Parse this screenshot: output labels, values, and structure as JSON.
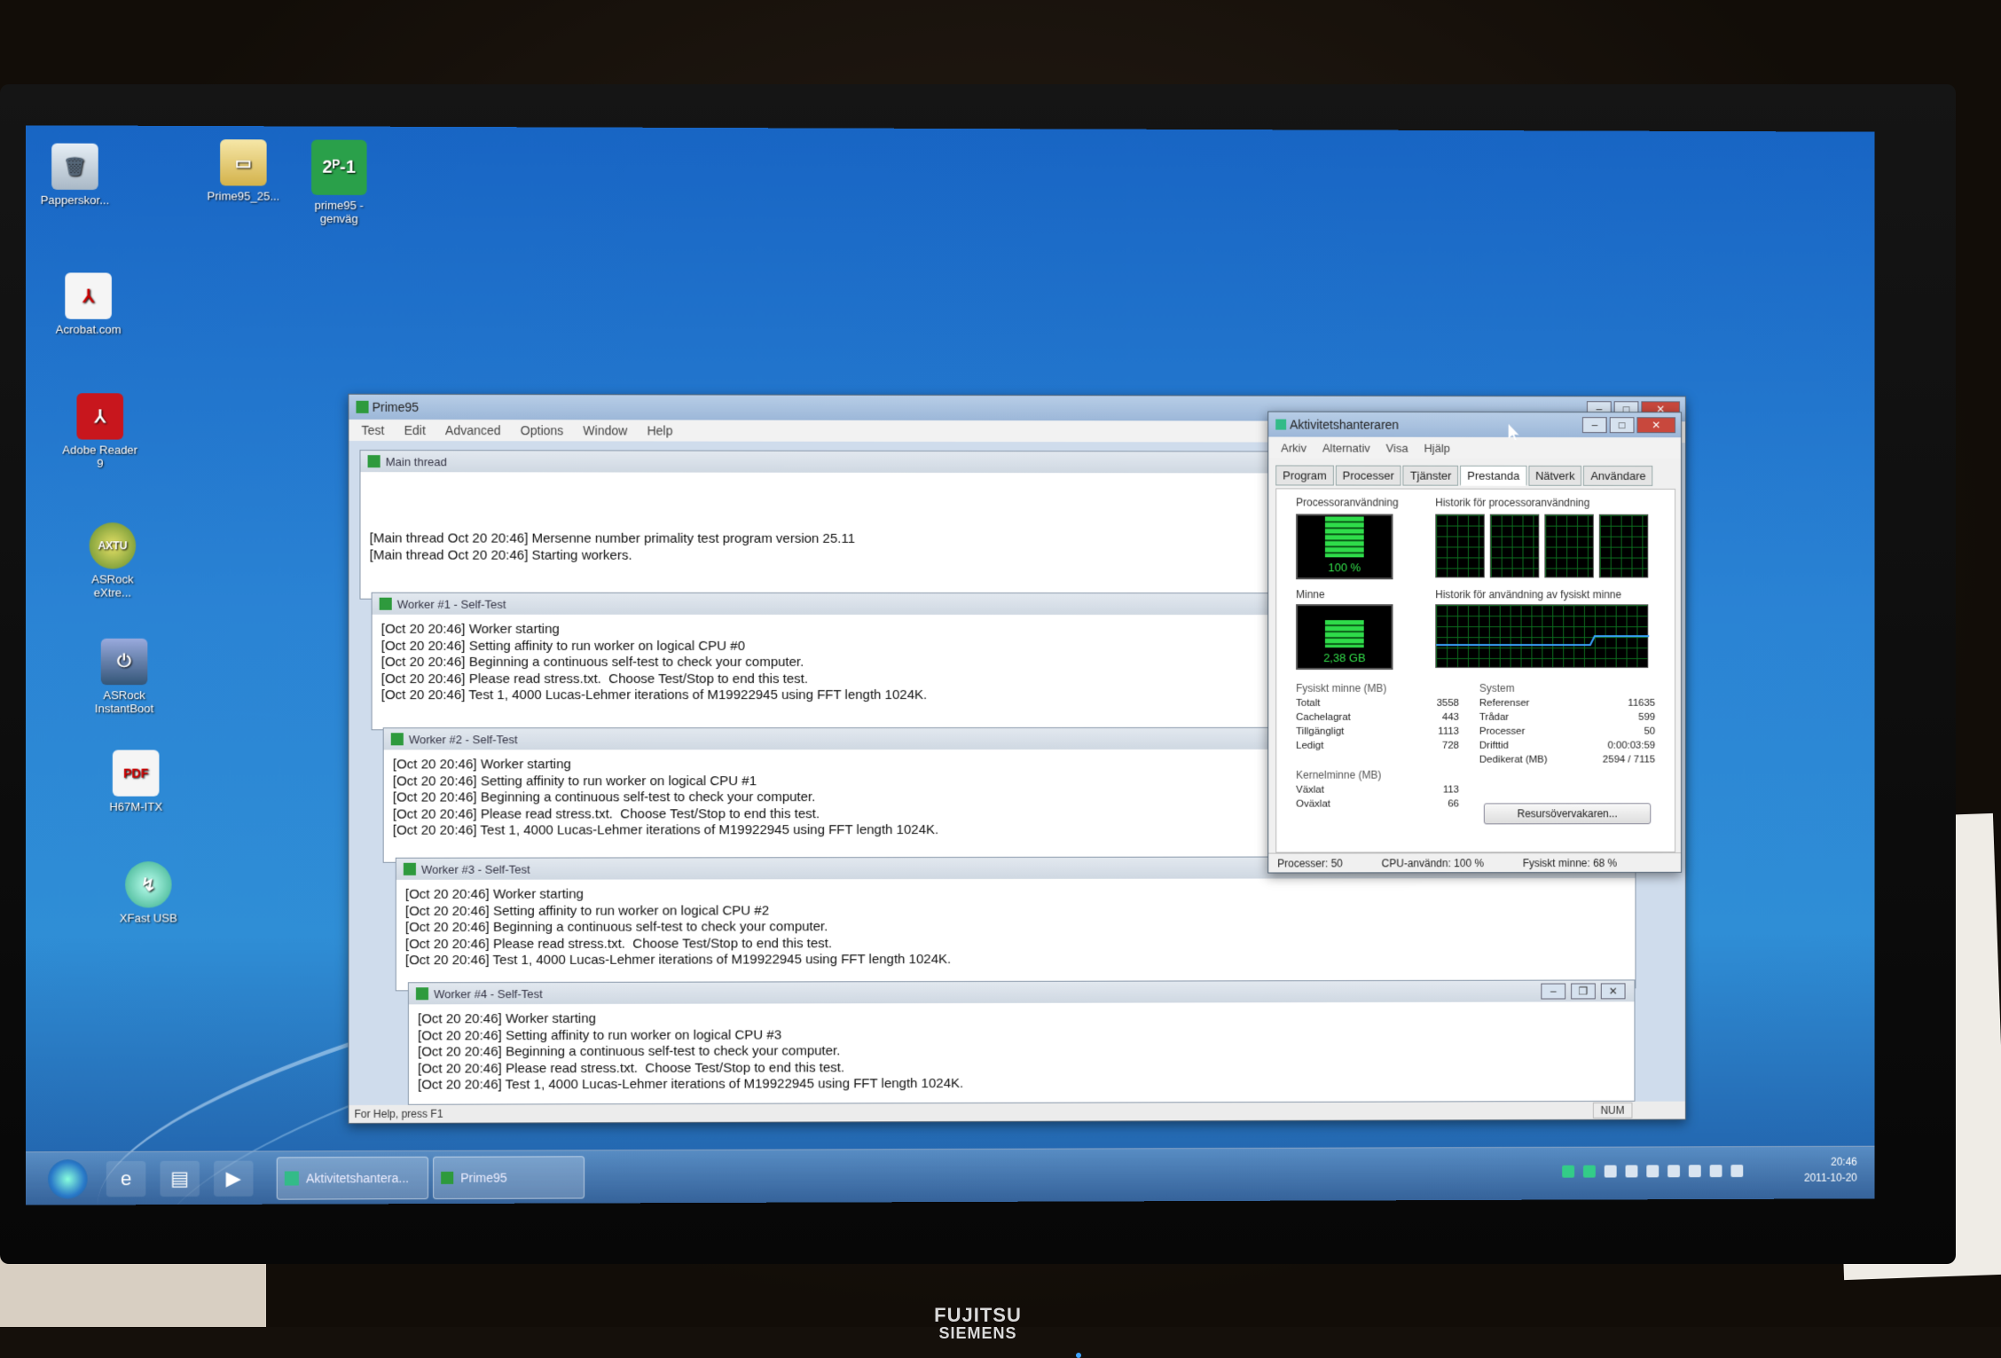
{
  "desktop": {
    "icons": [
      {
        "label": "Papperskor..."
      },
      {
        "label": "Prime95_25..."
      },
      {
        "label": "prime95 -"
      },
      {
        "label": "genväg"
      },
      {
        "label": "Acrobat.com"
      },
      {
        "label": "Adobe Reader"
      },
      {
        "label": "9"
      },
      {
        "label": "ASRock"
      },
      {
        "label": "eXtre..."
      },
      {
        "label": "ASRock"
      },
      {
        "label": "InstantBoot"
      },
      {
        "label": "H67M-ITX"
      },
      {
        "label": "XFast USB"
      }
    ]
  },
  "prime95": {
    "title": "Prime95",
    "menu": [
      "Test",
      "Edit",
      "Advanced",
      "Options",
      "Window",
      "Help"
    ],
    "main_thread": {
      "title": "Main thread",
      "lines": [
        "[Main thread Oct 20 20:46] Mersenne number primality test program version 25.11",
        "[Main thread Oct 20 20:46] Starting workers."
      ]
    },
    "workers": [
      {
        "title": "Worker #1 - Self-Test",
        "lines": [
          "[Oct 20 20:46] Worker starting",
          "[Oct 20 20:46] Setting affinity to run worker on logical CPU #0",
          "[Oct 20 20:46] Beginning a continuous self-test to check your computer.",
          "[Oct 20 20:46] Please read stress.txt.  Choose Test/Stop to end this test.",
          "[Oct 20 20:46] Test 1, 4000 Lucas-Lehmer iterations of M19922945 using FFT length 1024K."
        ]
      },
      {
        "title": "Worker #2 - Self-Test",
        "lines": [
          "[Oct 20 20:46] Worker starting",
          "[Oct 20 20:46] Setting affinity to run worker on logical CPU #1",
          "[Oct 20 20:46] Beginning a continuous self-test to check your computer.",
          "[Oct 20 20:46] Please read stress.txt.  Choose Test/Stop to end this test.",
          "[Oct 20 20:46] Test 1, 4000 Lucas-Lehmer iterations of M19922945 using FFT length 1024K."
        ]
      },
      {
        "title": "Worker #3 - Self-Test",
        "lines": [
          "[Oct 20 20:46] Worker starting",
          "[Oct 20 20:46] Setting affinity to run worker on logical CPU #2",
          "[Oct 20 20:46] Beginning a continuous self-test to check your computer.",
          "[Oct 20 20:46] Please read stress.txt.  Choose Test/Stop to end this test.",
          "[Oct 20 20:46] Test 1, 4000 Lucas-Lehmer iterations of M19922945 using FFT length 1024K."
        ]
      },
      {
        "title": "Worker #4 - Self-Test",
        "lines": [
          "[Oct 20 20:46] Worker starting",
          "[Oct 20 20:46] Setting affinity to run worker on logical CPU #3",
          "[Oct 20 20:46] Beginning a continuous self-test to check your computer.",
          "[Oct 20 20:46] Please read stress.txt.  Choose Test/Stop to end this test.",
          "[Oct 20 20:46] Test 1, 4000 Lucas-Lehmer iterations of M19922945 using FFT length 1024K."
        ]
      }
    ],
    "status_help": "For Help, press F1",
    "status_num": "NUM"
  },
  "taskmgr": {
    "title": "Aktivitetshanteraren",
    "menu": [
      "Arkiv",
      "Alternativ",
      "Visa",
      "Hjälp"
    ],
    "tabs": [
      "Program",
      "Processer",
      "Tjänster",
      "Prestanda",
      "Nätverk",
      "Användare"
    ],
    "active_tab": "Prestanda",
    "cpu_label": "Processoranvändning",
    "cpu_history_label": "Historik för processoranvändning",
    "cpu_value": "100 %",
    "cpu_fraction": 1.0,
    "mem_label": "Minne",
    "mem_history_label": "Historik för användning av fysiskt minne",
    "mem_value": "2,38 GB",
    "mem_fraction": 0.68,
    "phys": {
      "heading": "Fysiskt minne (MB)",
      "rows": [
        [
          "Totalt",
          "3558"
        ],
        [
          "Cachelagrat",
          "443"
        ],
        [
          "Tillgängligt",
          "1113"
        ],
        [
          "Ledigt",
          "728"
        ]
      ]
    },
    "kernel": {
      "heading": "Kernelminne (MB)",
      "rows": [
        [
          "Växlat",
          "113"
        ],
        [
          "Oväxlat",
          "66"
        ]
      ]
    },
    "system": {
      "heading": "System",
      "rows": [
        [
          "Referenser",
          "11635"
        ],
        [
          "Trådar",
          "599"
        ],
        [
          "Processer",
          "50"
        ],
        [
          "Drifttid",
          "0:00:03:59"
        ],
        [
          "Dedikerat (MB)",
          "2594 / 7115"
        ]
      ]
    },
    "resource_button": "Resursövervakaren...",
    "status": {
      "processes": "Processer: 50",
      "cpu": "CPU-användn: 100 %",
      "mem": "Fysiskt minne: 68 %"
    }
  },
  "taskbar": {
    "items": [
      {
        "label": "Aktivitetshantera..."
      },
      {
        "label": "Prime95"
      }
    ],
    "time": "20:46",
    "date": "2011-10-20"
  },
  "monitor": {
    "brand_line1": "FUJITSU",
    "brand_line2": "SIEMENS"
  }
}
